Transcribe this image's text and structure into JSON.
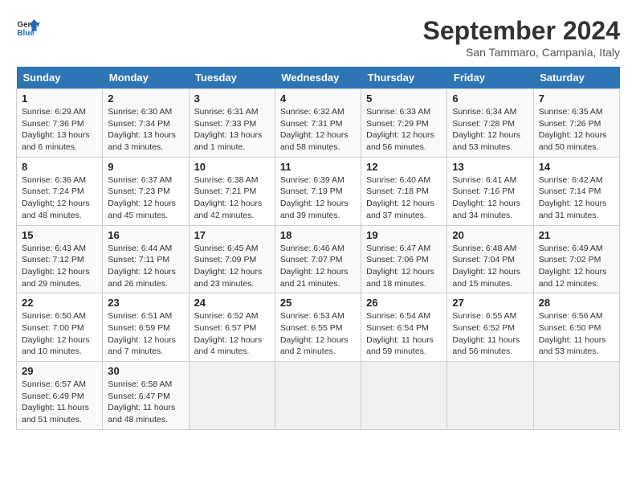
{
  "header": {
    "logo_line1": "General",
    "logo_line2": "Blue",
    "month_title": "September 2024",
    "location": "San Tammaro, Campania, Italy"
  },
  "weekdays": [
    "Sunday",
    "Monday",
    "Tuesday",
    "Wednesday",
    "Thursday",
    "Friday",
    "Saturday"
  ],
  "weeks": [
    [
      {
        "day": "1",
        "detail": "Sunrise: 6:29 AM\nSunset: 7:36 PM\nDaylight: 13 hours\nand 6 minutes."
      },
      {
        "day": "2",
        "detail": "Sunrise: 6:30 AM\nSunset: 7:34 PM\nDaylight: 13 hours\nand 3 minutes."
      },
      {
        "day": "3",
        "detail": "Sunrise: 6:31 AM\nSunset: 7:33 PM\nDaylight: 13 hours\nand 1 minute."
      },
      {
        "day": "4",
        "detail": "Sunrise: 6:32 AM\nSunset: 7:31 PM\nDaylight: 12 hours\nand 58 minutes."
      },
      {
        "day": "5",
        "detail": "Sunrise: 6:33 AM\nSunset: 7:29 PM\nDaylight: 12 hours\nand 56 minutes."
      },
      {
        "day": "6",
        "detail": "Sunrise: 6:34 AM\nSunset: 7:28 PM\nDaylight: 12 hours\nand 53 minutes."
      },
      {
        "day": "7",
        "detail": "Sunrise: 6:35 AM\nSunset: 7:26 PM\nDaylight: 12 hours\nand 50 minutes."
      }
    ],
    [
      {
        "day": "8",
        "detail": "Sunrise: 6:36 AM\nSunset: 7:24 PM\nDaylight: 12 hours\nand 48 minutes."
      },
      {
        "day": "9",
        "detail": "Sunrise: 6:37 AM\nSunset: 7:23 PM\nDaylight: 12 hours\nand 45 minutes."
      },
      {
        "day": "10",
        "detail": "Sunrise: 6:38 AM\nSunset: 7:21 PM\nDaylight: 12 hours\nand 42 minutes."
      },
      {
        "day": "11",
        "detail": "Sunrise: 6:39 AM\nSunset: 7:19 PM\nDaylight: 12 hours\nand 39 minutes."
      },
      {
        "day": "12",
        "detail": "Sunrise: 6:40 AM\nSunset: 7:18 PM\nDaylight: 12 hours\nand 37 minutes."
      },
      {
        "day": "13",
        "detail": "Sunrise: 6:41 AM\nSunset: 7:16 PM\nDaylight: 12 hours\nand 34 minutes."
      },
      {
        "day": "14",
        "detail": "Sunrise: 6:42 AM\nSunset: 7:14 PM\nDaylight: 12 hours\nand 31 minutes."
      }
    ],
    [
      {
        "day": "15",
        "detail": "Sunrise: 6:43 AM\nSunset: 7:12 PM\nDaylight: 12 hours\nand 29 minutes."
      },
      {
        "day": "16",
        "detail": "Sunrise: 6:44 AM\nSunset: 7:11 PM\nDaylight: 12 hours\nand 26 minutes."
      },
      {
        "day": "17",
        "detail": "Sunrise: 6:45 AM\nSunset: 7:09 PM\nDaylight: 12 hours\nand 23 minutes."
      },
      {
        "day": "18",
        "detail": "Sunrise: 6:46 AM\nSunset: 7:07 PM\nDaylight: 12 hours\nand 21 minutes."
      },
      {
        "day": "19",
        "detail": "Sunrise: 6:47 AM\nSunset: 7:06 PM\nDaylight: 12 hours\nand 18 minutes."
      },
      {
        "day": "20",
        "detail": "Sunrise: 6:48 AM\nSunset: 7:04 PM\nDaylight: 12 hours\nand 15 minutes."
      },
      {
        "day": "21",
        "detail": "Sunrise: 6:49 AM\nSunset: 7:02 PM\nDaylight: 12 hours\nand 12 minutes."
      }
    ],
    [
      {
        "day": "22",
        "detail": "Sunrise: 6:50 AM\nSunset: 7:00 PM\nDaylight: 12 hours\nand 10 minutes."
      },
      {
        "day": "23",
        "detail": "Sunrise: 6:51 AM\nSunset: 6:59 PM\nDaylight: 12 hours\nand 7 minutes."
      },
      {
        "day": "24",
        "detail": "Sunrise: 6:52 AM\nSunset: 6:57 PM\nDaylight: 12 hours\nand 4 minutes."
      },
      {
        "day": "25",
        "detail": "Sunrise: 6:53 AM\nSunset: 6:55 PM\nDaylight: 12 hours\nand 2 minutes."
      },
      {
        "day": "26",
        "detail": "Sunrise: 6:54 AM\nSunset: 6:54 PM\nDaylight: 11 hours\nand 59 minutes."
      },
      {
        "day": "27",
        "detail": "Sunrise: 6:55 AM\nSunset: 6:52 PM\nDaylight: 11 hours\nand 56 minutes."
      },
      {
        "day": "28",
        "detail": "Sunrise: 6:56 AM\nSunset: 6:50 PM\nDaylight: 11 hours\nand 53 minutes."
      }
    ],
    [
      {
        "day": "29",
        "detail": "Sunrise: 6:57 AM\nSunset: 6:49 PM\nDaylight: 11 hours\nand 51 minutes."
      },
      {
        "day": "30",
        "detail": "Sunrise: 6:58 AM\nSunset: 6:47 PM\nDaylight: 11 hours\nand 48 minutes."
      },
      null,
      null,
      null,
      null,
      null
    ]
  ]
}
